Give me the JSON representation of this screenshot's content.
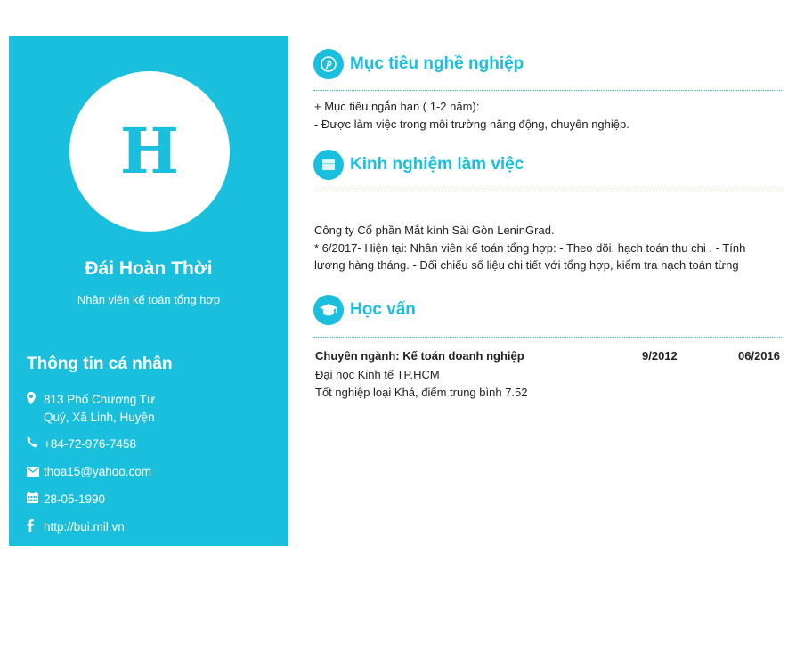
{
  "profile": {
    "avatar_letter": "H",
    "name": "Đái Hoàn Thời",
    "position": "Nhân viên kế toán tổng hợp"
  },
  "personal_info": {
    "title": "Thông tin cá nhân",
    "address_line1": "813 Phố Chương Từ",
    "address_line2": "Quý, Xã Linh, Huyện",
    "phone": "+84-72-976-7458",
    "email": "thoa15@yahoo.com",
    "birthday": "28-05-1990",
    "website": "http://bui.mil.vn"
  },
  "sections": {
    "objective": {
      "title": "Mục tiêu nghề nghiệp",
      "line1": "+ Mục tiêu ngắn hạn ( 1-2 năm):",
      "line2": "- Được làm việc trong môi trường năng động, chuyên nghiệp."
    },
    "experience": {
      "title": "Kinh nghiệm làm việc",
      "company": " Công ty Cổ phần Mắt kính Sài Gòn LeninGrad.",
      "line1": "* 6/2017- Hiện tại: Nhân viên kế toán tổng hợp: - Theo dõi, hạch toán thu chi . - Tính",
      "line2": "lương hàng tháng. - Đối chiếu số liệu chi tiết với tổng hợp, kiểm tra hạch toán từng"
    },
    "education": {
      "title": "Học vấn",
      "major": "Chuyên ngành: Kế toán doanh nghiệp",
      "start": "9/2012",
      "end": "06/2016",
      "school": "Đại học Kinh tế TP.HCM",
      "grade": "Tốt nghiệp loại Khá, điểm trung bình 7.52"
    }
  },
  "colors": {
    "accent": "#19bfdc",
    "text": "#222222",
    "background": "#ffffff"
  },
  "icons": {
    "objective": "pinterest-icon",
    "experience": "briefcase-icon",
    "education": "graduation-cap-icon",
    "address": "map-marker-icon",
    "phone": "phone-icon",
    "email": "envelope-icon",
    "birthday": "calendar-icon",
    "website": "facebook-icon"
  }
}
